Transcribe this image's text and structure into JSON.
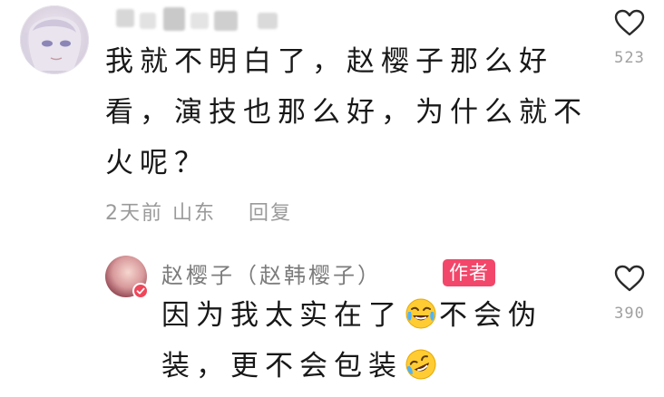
{
  "comment": {
    "text": "我就不明白了，赵樱子那么好看，演技也那么好，为什么就不火呢？",
    "time": "2天前",
    "location": "山东",
    "reply_label": "回复",
    "like_count": "523",
    "like_icon": "heart-outline-icon"
  },
  "reply": {
    "author_name": "赵樱子（赵韩樱子）",
    "author_badge": "作者",
    "text_part1": "因为我太实在了",
    "text_part2": "不会伪装，更不会包装",
    "emoji1": "crying-laughing-emoji",
    "emoji2": "rolling-laughing-emoji",
    "like_count": "390",
    "badge_color": "#f2476a",
    "verified_color": "#f0465a"
  }
}
